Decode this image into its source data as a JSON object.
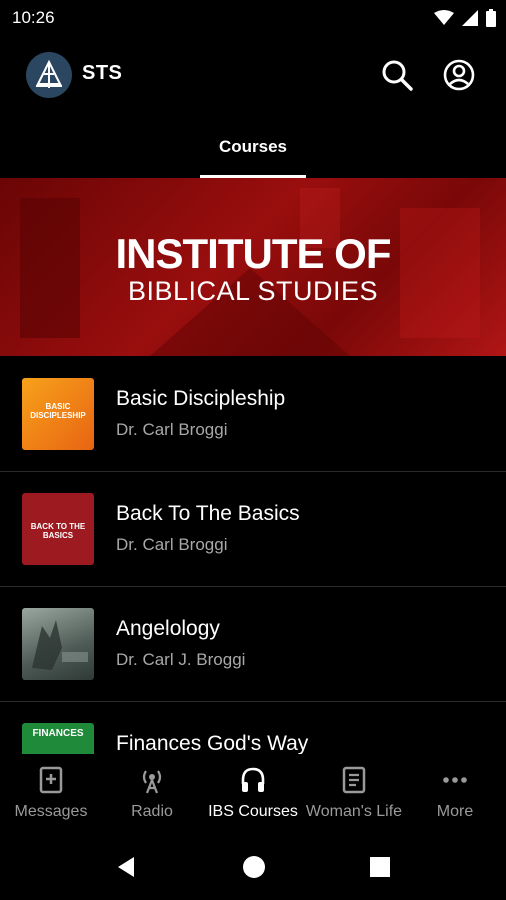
{
  "status": {
    "time": "10:26"
  },
  "app": {
    "title": "STS"
  },
  "tabs": [
    {
      "label": "Courses"
    }
  ],
  "banner": {
    "line1": "INSTITUTE OF",
    "line2": "BIBLICAL STUDIES"
  },
  "courses": [
    {
      "title": "Basic Discipleship",
      "author": "Dr. Carl Broggi",
      "thumb_text": "BASIC DISCIPLESHIP"
    },
    {
      "title": "Back To The Basics",
      "author": "Dr. Carl Broggi",
      "thumb_text": "BACK TO THE BASICS"
    },
    {
      "title": "Angelology",
      "author": "Dr. Carl J. Broggi",
      "thumb_text": ""
    },
    {
      "title": "Finances God's Way",
      "author": "",
      "thumb_text": "FINANCES"
    }
  ],
  "bottom_nav": [
    {
      "label": "Messages",
      "icon": "book-plus-icon"
    },
    {
      "label": "Radio",
      "icon": "radio-tower-icon"
    },
    {
      "label": "IBS Courses",
      "icon": "headphones-icon",
      "active": true
    },
    {
      "label": "Woman's Life",
      "icon": "open-book-icon"
    },
    {
      "label": "More",
      "icon": "more-dots-icon"
    }
  ],
  "colors": {
    "background": "#000000",
    "banner_red": "#9a0e0e",
    "muted_text": "#a8a8a8"
  }
}
